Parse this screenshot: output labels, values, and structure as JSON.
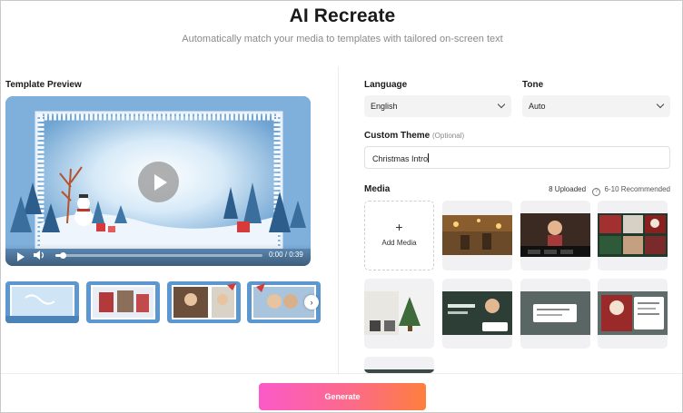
{
  "header": {
    "title": "AI Recreate",
    "subtitle": "Automatically match your media to templates with tailored on-screen text"
  },
  "preview": {
    "label": "Template Preview",
    "time": "0:00 / 0:39",
    "progress": 0.04
  },
  "form": {
    "language_label": "Language",
    "language_value": "English",
    "tone_label": "Tone",
    "tone_value": "Auto",
    "theme_label": "Custom Theme",
    "theme_optional": "(Optional)",
    "theme_value": "Christmas Intro"
  },
  "media": {
    "label": "Media",
    "uploaded": "8 Uploaded",
    "recommended": "6-10 Recommended",
    "add_label": "Add Media"
  },
  "footer": {
    "generate_label": "Generate"
  },
  "colors": {
    "accent_start": "#fb5ac7",
    "accent_end": "#fd7f3d"
  }
}
